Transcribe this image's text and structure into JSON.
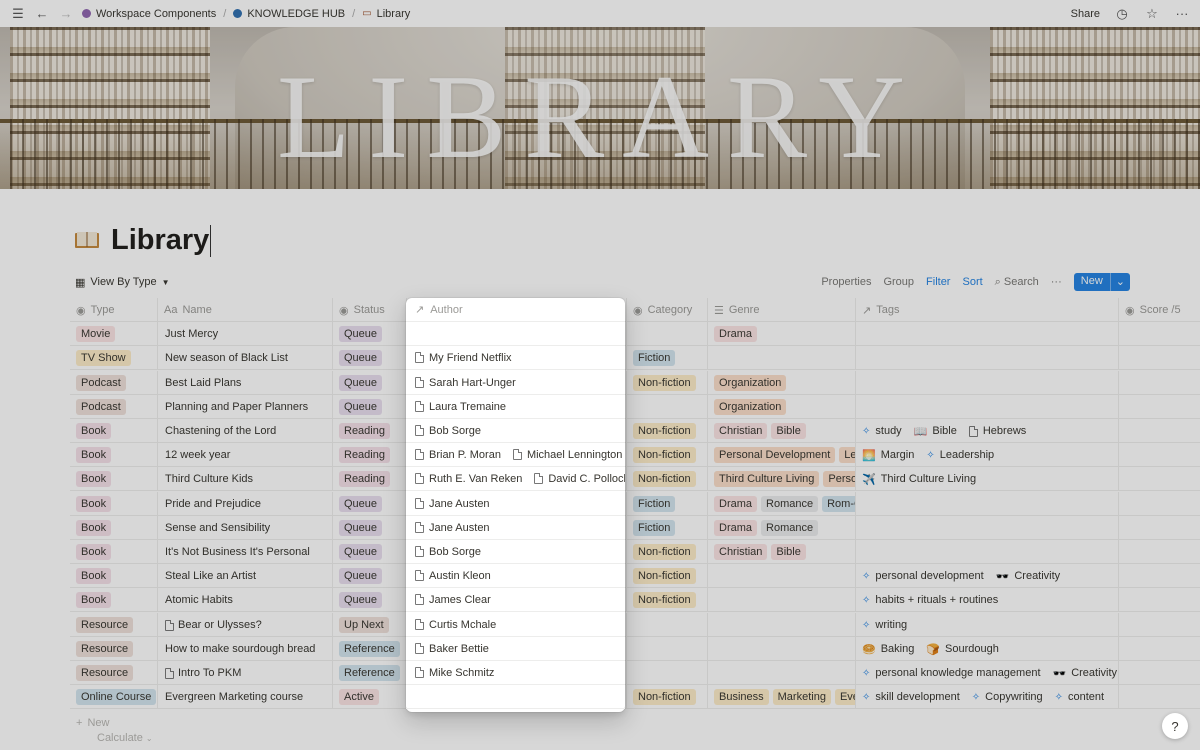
{
  "breadcrumb": [
    {
      "label": "Workspace Components",
      "color": "#9065b0"
    },
    {
      "label": "KNOWLEDGE HUB",
      "color": "#2f6fb0"
    },
    {
      "label": "Library",
      "icon": "book-icon"
    }
  ],
  "topbar": {
    "share_label": "Share",
    "history_icon": "clock-icon",
    "favorite_icon": "star-icon",
    "more_icon": "ellipsis-icon"
  },
  "banner": {
    "title": "LIBRARY"
  },
  "page": {
    "title": "Library",
    "icon": "open-book-icon"
  },
  "view": {
    "name": "View By Type",
    "actions": {
      "properties": "Properties",
      "group": "Group",
      "filter": "Filter",
      "sort": "Sort",
      "search": "Search",
      "more": "···",
      "new": "New"
    }
  },
  "columns": {
    "type": "Type",
    "name": "Name",
    "status": "Status",
    "author": "Author",
    "category": "Category",
    "genre": "Genre",
    "tags": "Tags",
    "score": "Score /5"
  },
  "colors": {
    "t-red": "#fbe4e4",
    "t-orange": "#fadec9",
    "t-yellow": "#fdecc8",
    "t-blue": "#d3e5ef",
    "t-purple": "#e8deee",
    "t-gray": "#ebeced",
    "t-pink": "#f5e0e9",
    "t-green": "#dbeddb",
    "t-brown": "#eee0da",
    "accent": "#2383e2"
  },
  "rows": [
    {
      "type": {
        "label": "Movie",
        "color": "t-red"
      },
      "name": "Just Mercy",
      "doc": false,
      "status": {
        "label": "Queue",
        "color": "t-purple"
      },
      "authors": [],
      "category": null,
      "genre": [
        {
          "label": "Drama",
          "color": "t-red"
        }
      ],
      "tags": []
    },
    {
      "type": {
        "label": "TV Show",
        "color": "t-yellow"
      },
      "name": "New season of Black List",
      "doc": false,
      "status": {
        "label": "Queue",
        "color": "t-purple"
      },
      "authors": [
        "My Friend Netflix"
      ],
      "category": {
        "label": "Fiction",
        "color": "t-blue"
      },
      "genre": [],
      "tags": []
    },
    {
      "type": {
        "label": "Podcast",
        "color": "t-brown"
      },
      "name": "Best Laid Plans",
      "doc": false,
      "status": {
        "label": "Queue",
        "color": "t-purple"
      },
      "authors": [
        "Sarah Hart-Unger"
      ],
      "category": {
        "label": "Non-fiction",
        "color": "t-yellow"
      },
      "genre": [
        {
          "label": "Organization",
          "color": "t-orange"
        }
      ],
      "tags": []
    },
    {
      "type": {
        "label": "Podcast",
        "color": "t-brown"
      },
      "name": "Planning and Paper Planners",
      "doc": false,
      "status": {
        "label": "Queue",
        "color": "t-purple"
      },
      "authors": [
        "Laura Tremaine"
      ],
      "category": null,
      "genre": [
        {
          "label": "Organization",
          "color": "t-orange"
        }
      ],
      "tags": []
    },
    {
      "type": {
        "label": "Book",
        "color": "t-pink"
      },
      "name": "Chastening of the Lord",
      "doc": false,
      "status": {
        "label": "Reading",
        "color": "t-pink"
      },
      "authors": [
        "Bob Sorge"
      ],
      "category": {
        "label": "Non-fiction",
        "color": "t-yellow"
      },
      "genre": [
        {
          "label": "Christian",
          "color": "t-red"
        },
        {
          "label": "Bible",
          "color": "t-red"
        }
      ],
      "tags": [
        {
          "icon": "diamond",
          "label": "study"
        },
        {
          "icon": "📖",
          "label": "Bible"
        },
        {
          "icon": "doc",
          "label": "Hebrews"
        }
      ]
    },
    {
      "type": {
        "label": "Book",
        "color": "t-pink"
      },
      "name": "12 week year",
      "doc": false,
      "status": {
        "label": "Reading",
        "color": "t-pink"
      },
      "authors": [
        "Brian P. Moran",
        "Michael Lennington"
      ],
      "category": {
        "label": "Non-fiction",
        "color": "t-yellow"
      },
      "genre": [
        {
          "label": "Personal Development",
          "color": "t-orange"
        },
        {
          "label": "Lea",
          "color": "t-orange"
        }
      ],
      "tags": [
        {
          "icon": "🌅",
          "label": "Margin"
        },
        {
          "icon": "diamond",
          "label": "Leadership"
        }
      ]
    },
    {
      "type": {
        "label": "Book",
        "color": "t-pink"
      },
      "name": "Third Culture Kids",
      "doc": false,
      "status": {
        "label": "Reading",
        "color": "t-pink"
      },
      "authors": [
        "Ruth E. Van Reken",
        "David C. Pollock"
      ],
      "category": {
        "label": "Non-fiction",
        "color": "t-yellow"
      },
      "genre": [
        {
          "label": "Third Culture Living",
          "color": "t-orange"
        },
        {
          "label": "Person",
          "color": "t-orange"
        }
      ],
      "tags": [
        {
          "icon": "✈️",
          "label": "Third Culture Living"
        }
      ]
    },
    {
      "type": {
        "label": "Book",
        "color": "t-pink"
      },
      "name": "Pride and Prejudice",
      "doc": false,
      "status": {
        "label": "Queue",
        "color": "t-purple"
      },
      "authors": [
        "Jane Austen"
      ],
      "category": {
        "label": "Fiction",
        "color": "t-blue"
      },
      "genre": [
        {
          "label": "Drama",
          "color": "t-red"
        },
        {
          "label": "Romance",
          "color": "t-gray"
        },
        {
          "label": "Rom-Co",
          "color": "t-blue"
        }
      ],
      "tags": []
    },
    {
      "type": {
        "label": "Book",
        "color": "t-pink"
      },
      "name": "Sense and Sensibility",
      "doc": false,
      "status": {
        "label": "Queue",
        "color": "t-purple"
      },
      "authors": [
        "Jane Austen"
      ],
      "category": {
        "label": "Fiction",
        "color": "t-blue"
      },
      "genre": [
        {
          "label": "Drama",
          "color": "t-red"
        },
        {
          "label": "Romance",
          "color": "t-gray"
        }
      ],
      "tags": []
    },
    {
      "type": {
        "label": "Book",
        "color": "t-pink"
      },
      "name": "It's Not Business It's Personal",
      "doc": false,
      "status": {
        "label": "Queue",
        "color": "t-purple"
      },
      "authors": [
        "Bob Sorge"
      ],
      "category": {
        "label": "Non-fiction",
        "color": "t-yellow"
      },
      "genre": [
        {
          "label": "Christian",
          "color": "t-red"
        },
        {
          "label": "Bible",
          "color": "t-red"
        }
      ],
      "tags": []
    },
    {
      "type": {
        "label": "Book",
        "color": "t-pink"
      },
      "name": "Steal Like an Artist",
      "doc": false,
      "status": {
        "label": "Queue",
        "color": "t-purple"
      },
      "authors": [
        "Austin Kleon"
      ],
      "category": {
        "label": "Non-fiction",
        "color": "t-yellow"
      },
      "genre": [],
      "tags": [
        {
          "icon": "diamond",
          "label": "personal development"
        },
        {
          "icon": "🕶️",
          "label": "Creativity"
        }
      ]
    },
    {
      "type": {
        "label": "Book",
        "color": "t-pink"
      },
      "name": "Atomic Habits",
      "doc": false,
      "status": {
        "label": "Queue",
        "color": "t-purple"
      },
      "authors": [
        "James Clear"
      ],
      "category": {
        "label": "Non-fiction",
        "color": "t-yellow"
      },
      "genre": [],
      "tags": [
        {
          "icon": "diamond",
          "label": "habits + rituals + routines"
        }
      ]
    },
    {
      "type": {
        "label": "Resource",
        "color": "t-brown"
      },
      "name": "Bear or Ulysses?",
      "doc": true,
      "status": {
        "label": "Up Next",
        "color": "t-brown"
      },
      "authors": [
        "Curtis Mchale"
      ],
      "category": null,
      "genre": [],
      "tags": [
        {
          "icon": "diamond",
          "label": "writing"
        }
      ]
    },
    {
      "type": {
        "label": "Resource",
        "color": "t-brown"
      },
      "name": "How to make sourdough bread",
      "doc": false,
      "status": {
        "label": "Reference",
        "color": "t-blue"
      },
      "authors": [
        "Baker Bettie"
      ],
      "category": null,
      "genre": [],
      "tags": [
        {
          "icon": "🥯",
          "label": "Baking"
        },
        {
          "icon": "🍞",
          "label": "Sourdough"
        }
      ]
    },
    {
      "type": {
        "label": "Resource",
        "color": "t-brown"
      },
      "name": "Intro To PKM",
      "doc": true,
      "status": {
        "label": "Reference",
        "color": "t-blue"
      },
      "authors": [
        "Mike Schmitz"
      ],
      "category": null,
      "genre": [],
      "tags": [
        {
          "icon": "diamond",
          "label": "personal knowledge management"
        },
        {
          "icon": "🕶️",
          "label": "Creativity"
        }
      ]
    },
    {
      "type": {
        "label": "Online Course",
        "color": "t-blue"
      },
      "name": "Evergreen Marketing course",
      "doc": false,
      "status": {
        "label": "Active",
        "color": "t-red"
      },
      "authors": [],
      "category": {
        "label": "Non-fiction",
        "color": "t-yellow"
      },
      "genre": [
        {
          "label": "Business",
          "color": "t-yellow"
        },
        {
          "label": "Marketing",
          "color": "t-yellow"
        },
        {
          "label": "Ever",
          "color": "t-yellow"
        }
      ],
      "tags": [
        {
          "icon": "diamond",
          "label": "skill development"
        },
        {
          "icon": "diamond",
          "label": "Copywriting"
        },
        {
          "icon": "diamond",
          "label": "content"
        }
      ]
    }
  ],
  "footer": {
    "new_label": "New",
    "calculate_label": "Calculate"
  },
  "help": {
    "label": "?"
  }
}
